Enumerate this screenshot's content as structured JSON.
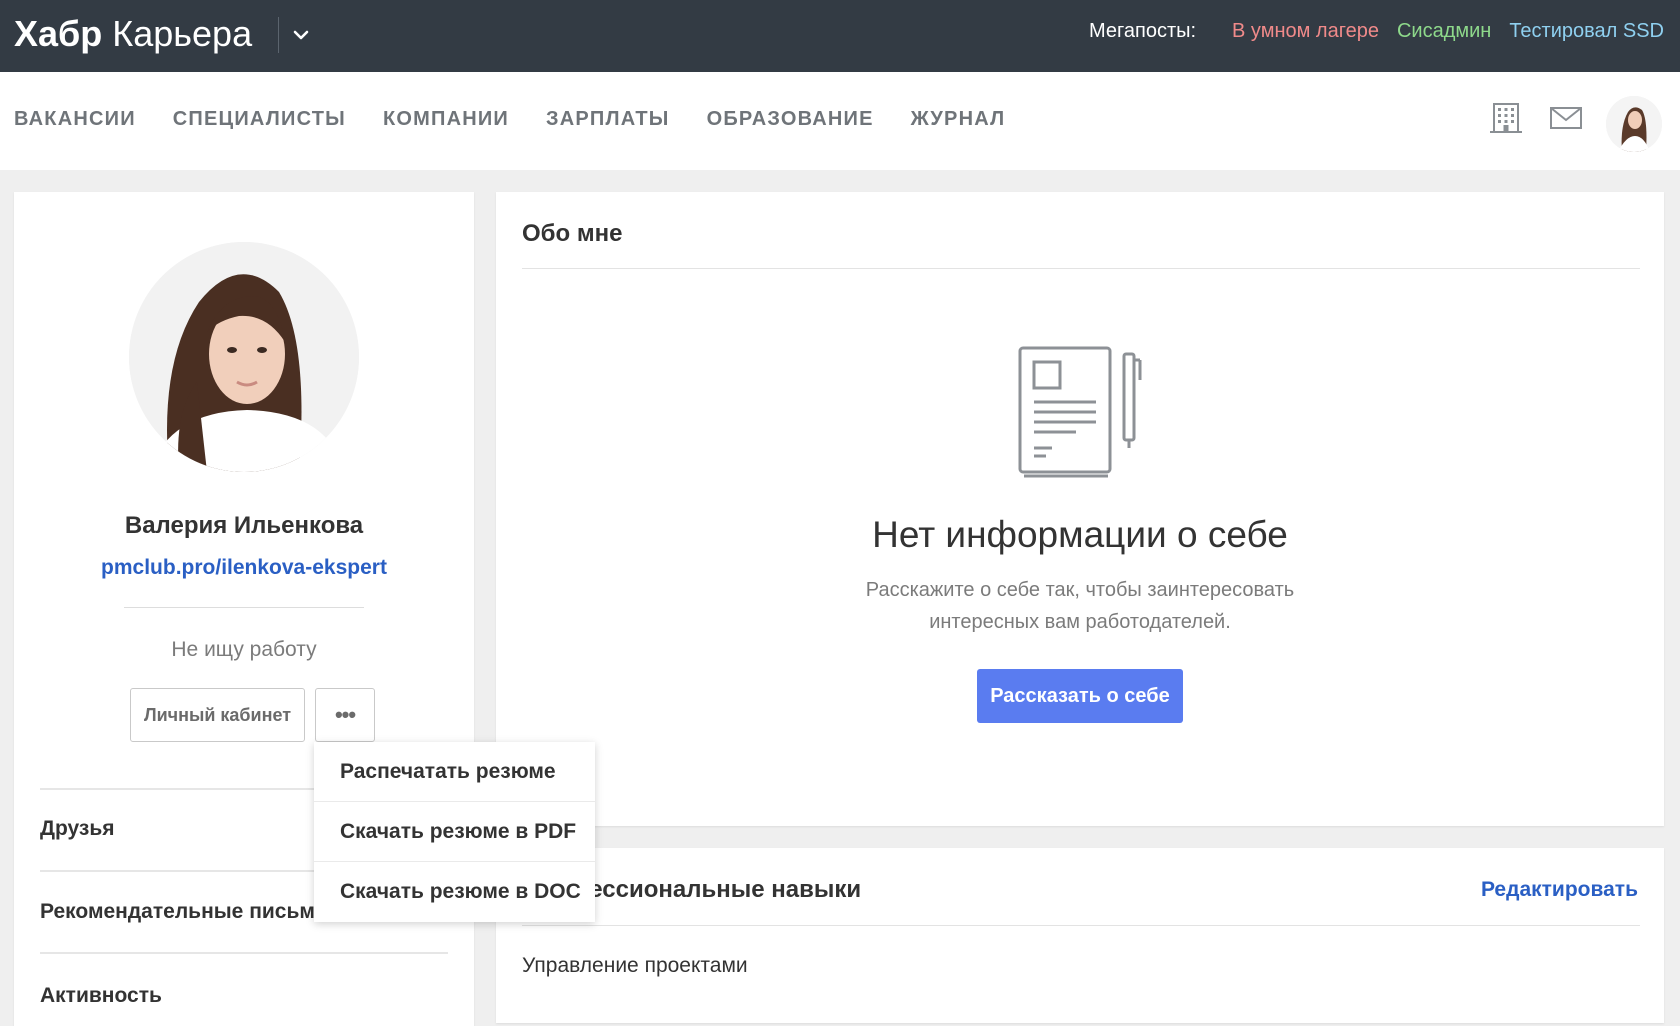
{
  "header": {
    "logo_main": "Хабр",
    "logo_sub": "Карьера",
    "megaposts_label": "Мегапосты:",
    "megaposts": [
      {
        "label": "В умном лагере",
        "color": "#f08a8a"
      },
      {
        "label": "Сисадмин",
        "color": "#8ed98b"
      },
      {
        "label": "Тестировал SSD",
        "color": "#8fd0f0"
      }
    ]
  },
  "nav": {
    "items": [
      "ВАКАНСИИ",
      "СПЕЦИАЛИСТЫ",
      "КОМПАНИИ",
      "ЗАРПЛАТЫ",
      "ОБРАЗОВАНИЕ",
      "ЖУРНАЛ"
    ],
    "icons": [
      "building-icon",
      "mail-icon"
    ]
  },
  "profile": {
    "name": "Валерия Ильенкова",
    "link": "pmclub.pro/ilenkova-ekspert",
    "status": "Не ищу работу",
    "cabinet_button": "Личный кабинет",
    "more_button": "•••",
    "side_links": [
      "Друзья",
      "Рекомендательные письма",
      "Активность"
    ]
  },
  "dropdown": {
    "items": [
      "Распечатать резюме",
      "Скачать резюме в PDF",
      "Скачать резюме в DOC"
    ]
  },
  "about": {
    "title": "Обо мне",
    "empty_title": "Нет информации о себе",
    "empty_text": "Расскажите о себе так, чтобы заинтересовать интересных вам работодателей.",
    "button": "Рассказать о себе"
  },
  "skills": {
    "title": "Профессиональные навыки",
    "edit": "Редактировать",
    "items": [
      "Управление проектами"
    ]
  }
}
